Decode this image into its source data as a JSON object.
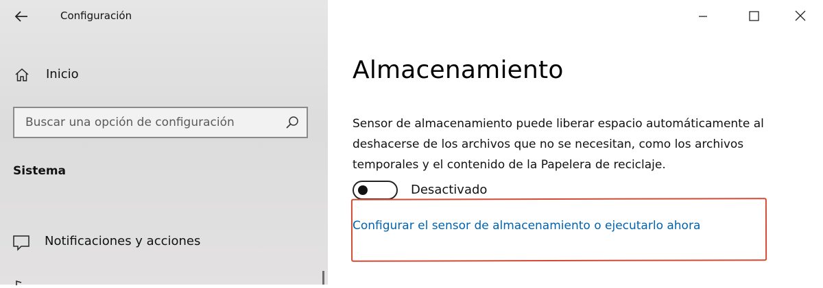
{
  "window": {
    "app_title": "Configuración",
    "controls": {
      "minimize_icon": "minimize-icon",
      "maximize_icon": "maximize-icon",
      "close_icon": "close-icon"
    }
  },
  "sidebar": {
    "back_icon": "back-arrow-icon",
    "home": {
      "label": "Inicio",
      "icon": "home-icon"
    },
    "search": {
      "placeholder": "Buscar una opción de configuración",
      "icon": "search-icon"
    },
    "section_title": "Sistema",
    "items": [
      {
        "label": "Notificaciones y acciones",
        "icon": "notifications-icon"
      }
    ]
  },
  "main": {
    "page_title": "Almacenamiento",
    "description": "Sensor de almacenamiento puede liberar espacio automáticamente al deshacerse de los archivos que no se necesitan, como los archivos temporales y el contenido de la Papelera de reciclaje.",
    "toggle": {
      "state": "off",
      "label": "Desactivado"
    },
    "link_label": "Configurar el sensor de almacenamiento o ejecutarlo ahora"
  },
  "colors": {
    "accent_link": "#0063b1",
    "highlight_border": "#d24a33",
    "sidebar_bg": "#e2e2e2"
  }
}
